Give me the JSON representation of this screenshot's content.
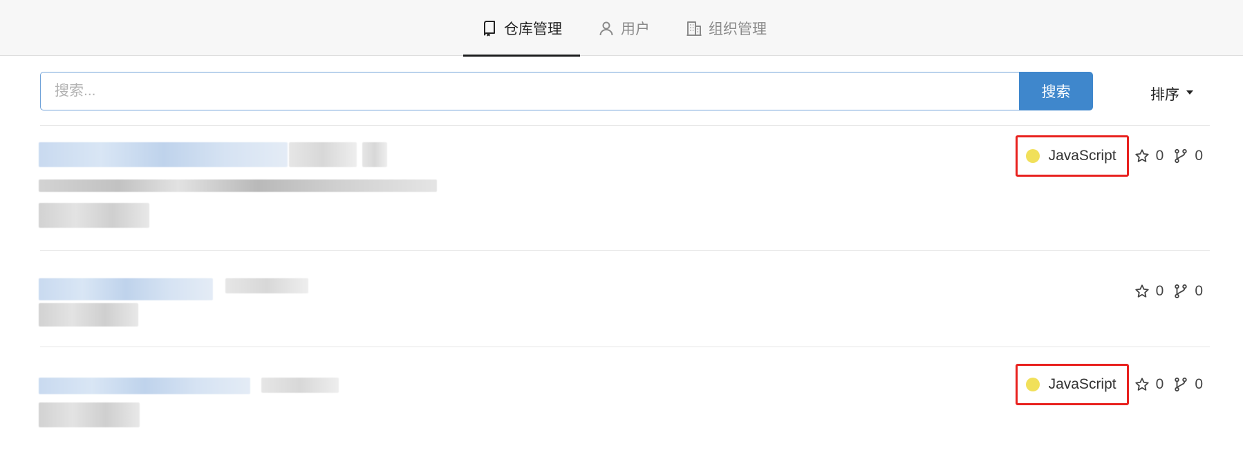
{
  "nav": {
    "tabs": [
      {
        "label": "仓库管理",
        "icon": "repo-icon",
        "active": true
      },
      {
        "label": "用户",
        "icon": "user-icon",
        "active": false
      },
      {
        "label": "组织管理",
        "icon": "organization-icon",
        "active": false
      }
    ]
  },
  "search": {
    "placeholder": "搜索...",
    "value": "",
    "button_label": "搜索"
  },
  "sort": {
    "label": "排序",
    "icon": "caret-down-icon"
  },
  "repos": [
    {
      "language": "JavaScript",
      "language_color": "#f1e05a",
      "stars": "0",
      "forks": "0",
      "language_highlighted": true
    },
    {
      "language": "",
      "language_color": "",
      "stars": "0",
      "forks": "0",
      "language_highlighted": false
    },
    {
      "language": "JavaScript",
      "language_color": "#f1e05a",
      "stars": "0",
      "forks": "0",
      "language_highlighted": true
    }
  ],
  "colors": {
    "accent": "#3f87cc",
    "highlight_box": "#e8211e",
    "javascript": "#f1e05a"
  }
}
